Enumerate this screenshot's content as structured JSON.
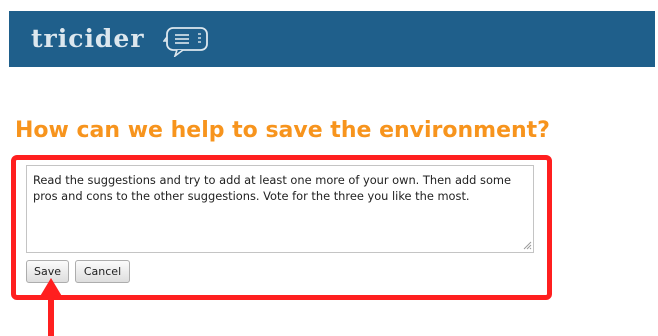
{
  "header": {
    "logo_text": "tricider",
    "logo_icon": "speech-bubble-icon",
    "brand_color": "#1f5f8b"
  },
  "question": {
    "title": "How can we help to save the environment?",
    "color": "#f7941d"
  },
  "editor": {
    "value": "Read the suggestions and try to add at least one more of your own. Then add some pros and cons to the other suggestions. Vote for the three you like the most."
  },
  "buttons": {
    "save_label": "Save",
    "cancel_label": "Cancel"
  },
  "annotation": {
    "highlight_color": "#ff1f1f",
    "highlight_icon": "red-highlight-frame",
    "arrow_icon": "red-arrow-up-icon"
  }
}
